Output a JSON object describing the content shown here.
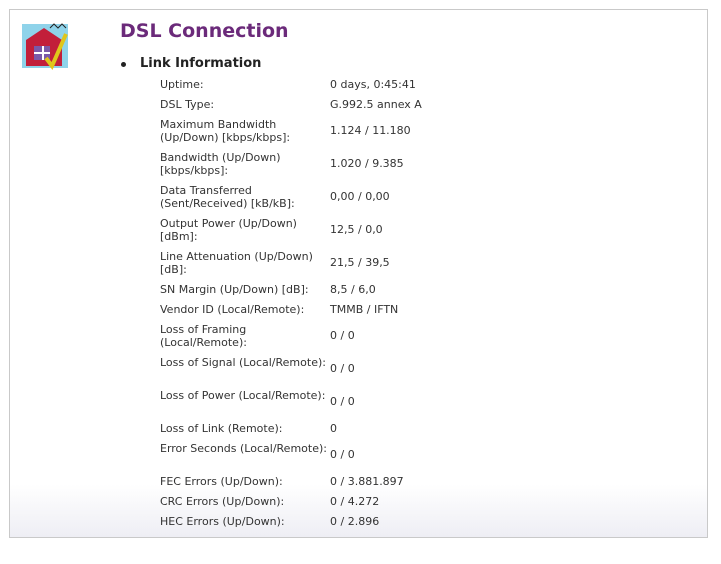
{
  "page": {
    "title": "DSL Connection",
    "section_title": "Link Information"
  },
  "icons": {
    "logo": "house-with-checkmark-logo-icon"
  },
  "rows": [
    {
      "label": "Uptime:",
      "value": "0 days, 0:45:41"
    },
    {
      "label": "DSL Type:",
      "value": "G.992.5 annex A"
    },
    {
      "label": "Maximum Bandwidth (Up/Down) [kbps/kbps]:",
      "value": "1.124 / 11.180"
    },
    {
      "label": "Bandwidth (Up/Down) [kbps/kbps]:",
      "value": "1.020 / 9.385"
    },
    {
      "label": "Data Transferred (Sent/Received) [kB/kB]:",
      "value": "0,00 / 0,00"
    },
    {
      "label": "Output Power (Up/Down) [dBm]:",
      "value": "12,5 / 0,0"
    },
    {
      "label": "Line Attenuation (Up/Down) [dB]:",
      "value": "21,5 / 39,5"
    },
    {
      "label": "SN Margin (Up/Down) [dB]:",
      "value": "8,5 / 6,0"
    },
    {
      "label": "Vendor ID (Local/Remote):",
      "value": "TMMB / IFTN"
    },
    {
      "label": "Loss of Framing (Local/Remote):",
      "value": "0 / 0"
    },
    {
      "label": "Loss of Signal (Local/Remote):",
      "value": "0 / 0"
    },
    {
      "label": "Loss of Power (Local/Remote):",
      "value": "0 / 0"
    },
    {
      "label": "Loss of Link (Remote):",
      "value": "0"
    },
    {
      "label": "Error Seconds (Local/Remote):",
      "value": "0 / 0"
    },
    {
      "label": "FEC Errors (Up/Down):",
      "value": "0 / 3.881.897"
    },
    {
      "label": "CRC Errors (Up/Down):",
      "value": "0 / 4.272"
    },
    {
      "label": "HEC Errors (Up/Down):",
      "value": "0 / 2.896"
    }
  ]
}
